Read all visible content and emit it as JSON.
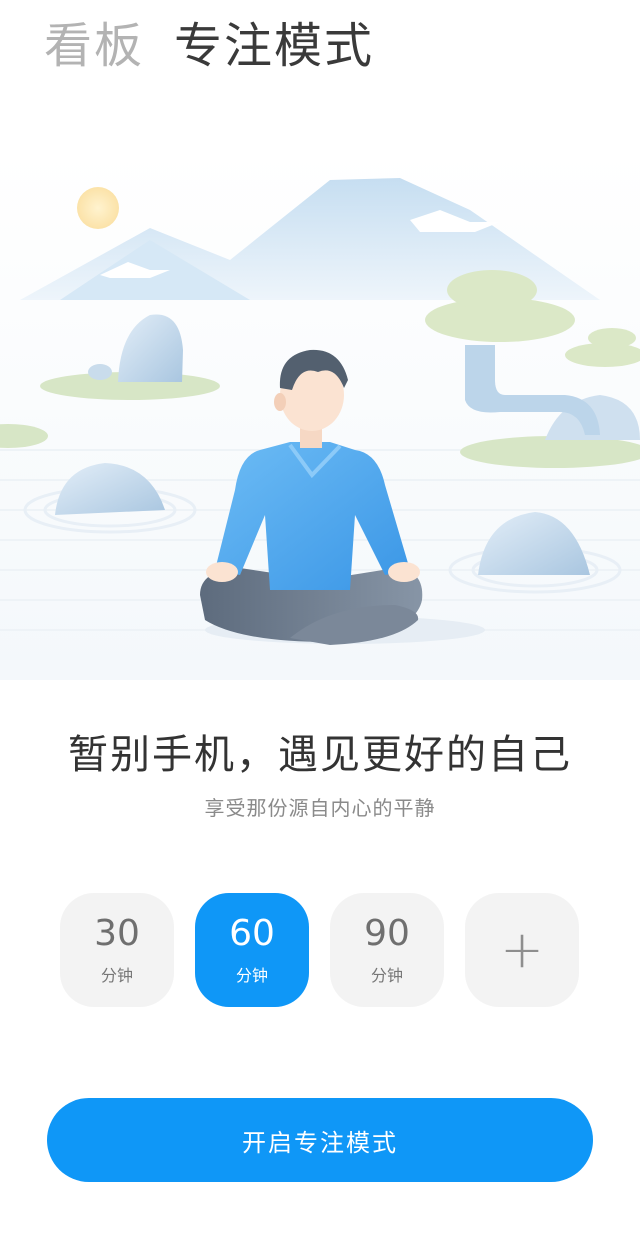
{
  "header": {
    "tabs": [
      {
        "label": "看板",
        "active": false
      },
      {
        "label": "专注模式",
        "active": true
      }
    ]
  },
  "illustration": {
    "subject": "meditating-person-icon",
    "colors": {
      "shirt": "#5aaef0",
      "legs": "#6c7a8c",
      "mountain": "#cfe3f2",
      "grass": "#d9e8c9",
      "sun": "#fde9b5"
    }
  },
  "main": {
    "headline": "暂别手机，遇见更好的自己",
    "subline": "享受那份源自内心的平静"
  },
  "durations": {
    "options": [
      {
        "value": "30",
        "unit": "分钟",
        "selected": false
      },
      {
        "value": "60",
        "unit": "分钟",
        "selected": true
      },
      {
        "value": "90",
        "unit": "分钟",
        "selected": false
      }
    ],
    "add_icon": "plus-icon"
  },
  "actions": {
    "start_label": "开启专注模式"
  },
  "colors": {
    "accent": "#0f97f7",
    "option_bg": "#f3f3f3"
  }
}
